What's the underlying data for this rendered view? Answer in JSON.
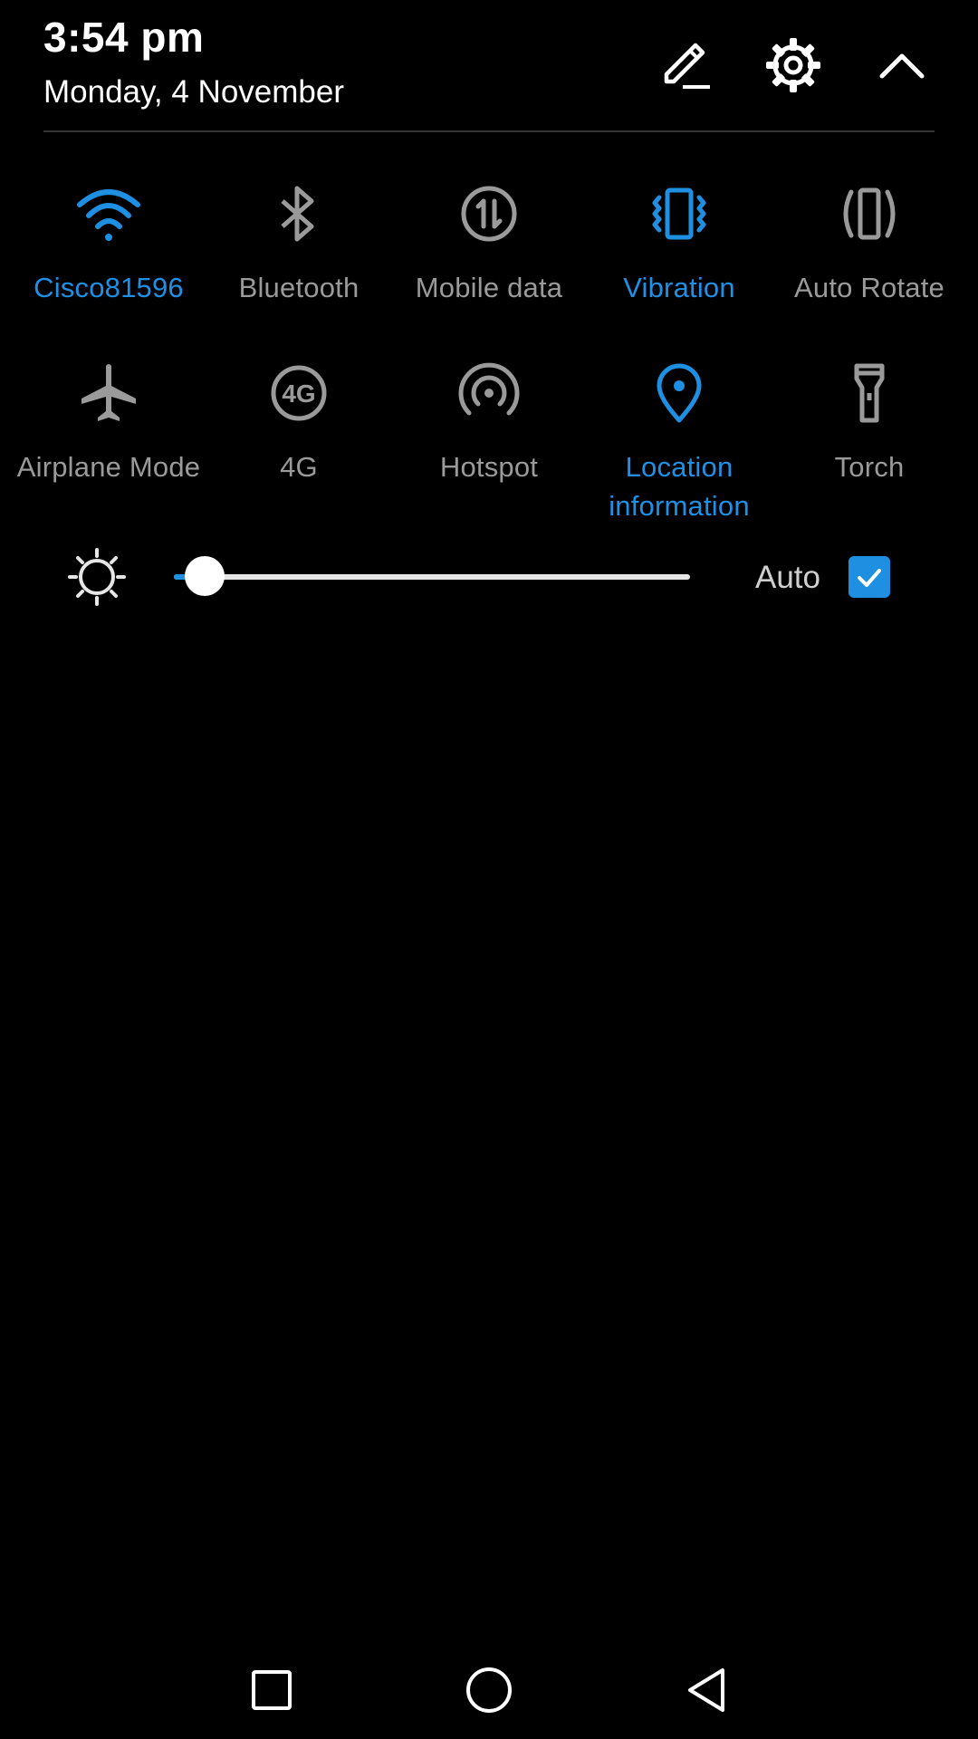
{
  "header": {
    "time": "3:54 pm",
    "date": "Monday, 4 November",
    "icons": [
      "edit-icon",
      "settings-icon",
      "collapse-icon"
    ]
  },
  "tiles": [
    {
      "label": "Cisco81596",
      "icon": "wifi-icon",
      "active": true
    },
    {
      "label": "Bluetooth",
      "icon": "bluetooth-icon",
      "active": false
    },
    {
      "label": "Mobile data",
      "icon": "mobile-data-icon",
      "active": false
    },
    {
      "label": "Vibration",
      "icon": "vibration-icon",
      "active": true
    },
    {
      "label": "Auto Rotate",
      "icon": "auto-rotate-icon",
      "active": false
    },
    {
      "label": "Airplane Mode",
      "icon": "airplane-icon",
      "active": false
    },
    {
      "label": "4G",
      "icon": "4g-icon",
      "active": false
    },
    {
      "label": "Hotspot",
      "icon": "hotspot-icon",
      "active": false
    },
    {
      "label": "Location information",
      "icon": "location-icon",
      "active": true
    },
    {
      "label": "Torch",
      "icon": "torch-icon",
      "active": false
    }
  ],
  "brightness": {
    "icon": "brightness-icon",
    "level": 0.06,
    "auto_label": "Auto",
    "auto_checked": true
  },
  "navbar": {
    "icons": [
      "recent-apps-icon",
      "home-icon",
      "back-icon"
    ]
  },
  "colors": {
    "accent": "#1e8fe1",
    "inactive": "#9a9a9a",
    "background": "#000000"
  }
}
